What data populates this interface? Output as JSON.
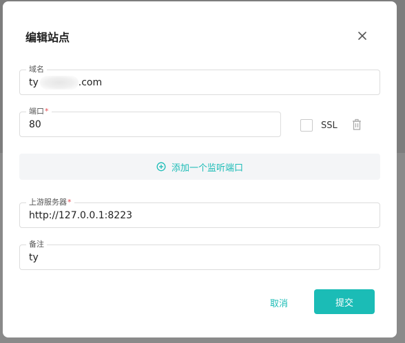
{
  "dialog": {
    "title": "编辑站点"
  },
  "form": {
    "domain": {
      "label": "域名",
      "value_prefix": "ty",
      "value_suffix": ".com"
    },
    "port": {
      "label": "端口",
      "required_mark": "*",
      "value": "80"
    },
    "ssl": {
      "label": "SSL",
      "checked": false
    },
    "add_listen_port": {
      "label": "添加一个监听端口"
    },
    "upstream": {
      "label": "上游服务器",
      "required_mark": "*",
      "value": "http://127.0.0.1:8223"
    },
    "remark": {
      "label": "备注",
      "value": "ty"
    }
  },
  "actions": {
    "cancel_label": "取消",
    "submit_label": "提交"
  },
  "icons": {
    "close": "close-icon",
    "trash": "trash-icon",
    "add": "plus-circle-icon"
  },
  "colors": {
    "accent": "#1bbcb6",
    "required": "#e5484d"
  }
}
